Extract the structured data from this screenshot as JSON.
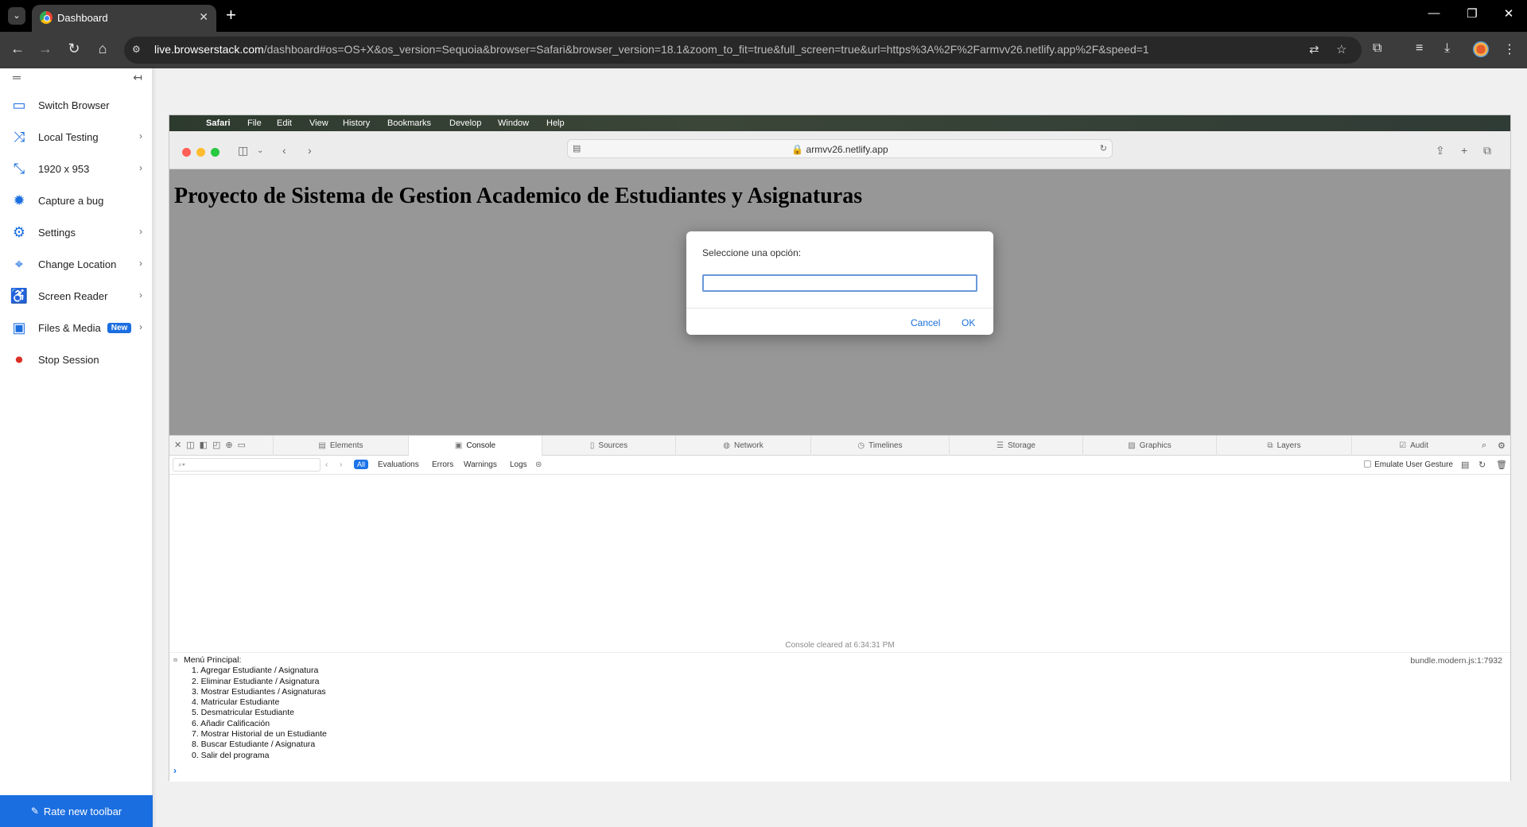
{
  "browser": {
    "tab_title": "Dashboard",
    "url_domain": "live.browserstack.com",
    "url_rest": "/dashboard#os=OS+X&os_version=Sequoia&browser=Safari&browser_version=18.1&zoom_to_fit=true&full_screen=true&url=https%3A%2F%2Farmvv26.netlify.app%2F&speed=1"
  },
  "sidebar": {
    "items": [
      {
        "label": "Switch Browser"
      },
      {
        "label": "Local Testing"
      },
      {
        "label": "1920 x 953"
      },
      {
        "label": "Capture a bug"
      },
      {
        "label": "Settings"
      },
      {
        "label": "Change Location"
      },
      {
        "label": "Screen Reader"
      },
      {
        "label": "Files & Media",
        "badge": "New"
      },
      {
        "label": "Stop Session"
      }
    ],
    "rate_label": "Rate new toolbar"
  },
  "mac_menu": [
    "Safari",
    "File",
    "Edit",
    "View",
    "History",
    "Bookmarks",
    "Develop",
    "Window",
    "Help"
  ],
  "safari": {
    "url": "armvv26.netlify.app"
  },
  "page": {
    "heading": "Proyecto de Sistema de Gestion Academico de Estudiantes y Asignaturas"
  },
  "dialog": {
    "message": "Seleccione una opción:",
    "input_value": "",
    "cancel": "Cancel",
    "ok": "OK"
  },
  "devtools": {
    "tabs": [
      "Elements",
      "Console",
      "Sources",
      "Network",
      "Timelines",
      "Storage",
      "Graphics",
      "Layers",
      "Audit"
    ],
    "active_tab": "Console",
    "filters": [
      "All",
      "Evaluations",
      "Errors",
      "Warnings",
      "Logs"
    ],
    "emulate": "Emulate User Gesture",
    "cleared": "Console cleared at 6:34:31 PM",
    "source": "bundle.modern.js:1:7932",
    "lines": [
      "Menú Principal:",
      "1. Agregar Estudiante / Asignatura",
      "2. Eliminar Estudiante / Asignatura",
      "3. Mostrar Estudiantes / Asignaturas",
      "4. Matricular Estudiante",
      "5. Desmatricular Estudiante",
      "6. Añadir Calificación",
      "7. Mostrar Historial de un Estudiante",
      "8. Buscar Estudiante / Asignatura",
      "0. Salir del programa"
    ]
  }
}
